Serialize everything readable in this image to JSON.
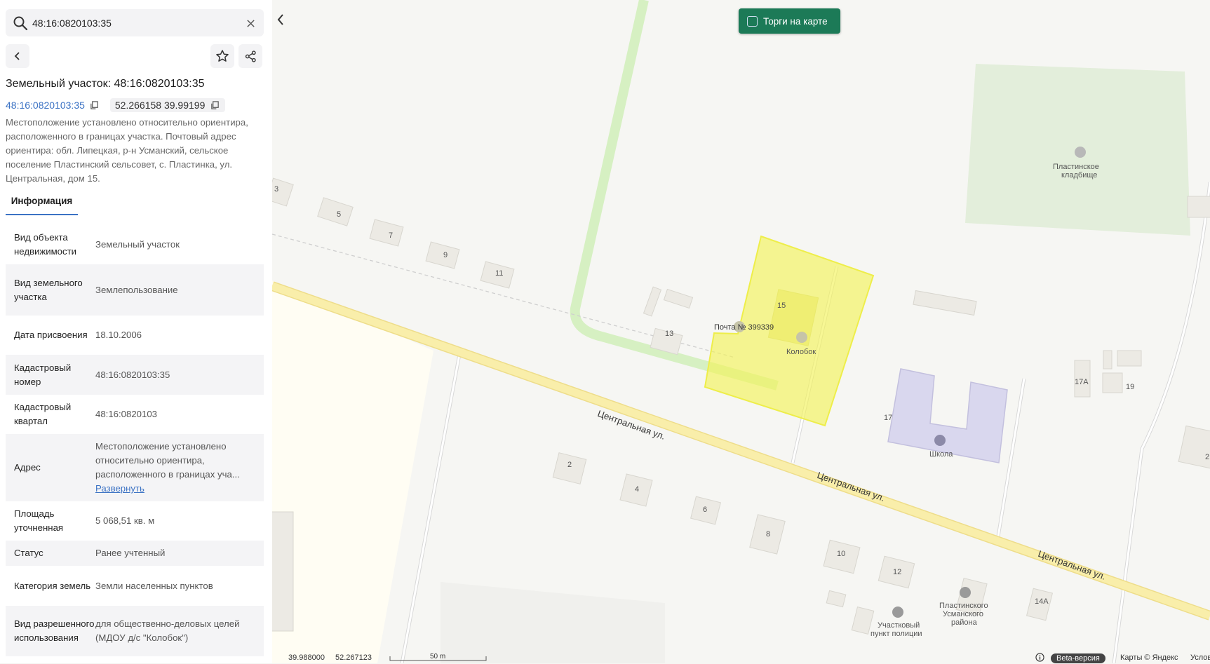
{
  "search": {
    "value": "48:16:0820103:35",
    "placeholder": ""
  },
  "title": "Земельный участок: 48:16:0820103:35",
  "cadastral_number": "48:16:0820103:35",
  "coordinates": "52.266158 39.99199",
  "description": "Местоположение установлено относительно ориентира, расположенного в границах участка. Почтовый адрес ориентира: обл. Липецкая, р-н Усманский, сельское поселение Пластинский сельсовет, с. Пластинка, ул. Центральная, дом 15.",
  "tabs": [
    {
      "label": "Информация"
    }
  ],
  "info": [
    {
      "key": "Вид объекта недвижимости",
      "value": "Земельный участок"
    },
    {
      "key": "Вид земельного участка",
      "value": "Землепользование"
    },
    {
      "key": "Дата присвоения",
      "value": "18.10.2006"
    },
    {
      "key": "Кадастровый номер",
      "value": "48:16:0820103:35"
    },
    {
      "key": "Кадастровый квартал",
      "value": "48:16:0820103"
    },
    {
      "key": "Адрес",
      "value": "Местоположение установлено относительно ориентира, расположенного в границах уча...",
      "link": "Развернуть"
    },
    {
      "key": "Площадь уточненная",
      "value": "5 068,51 кв. м"
    },
    {
      "key": "Статус",
      "value": "Ранее учтенный"
    },
    {
      "key": "Категория земель",
      "value": "Земли населенных пунктов"
    },
    {
      "key": "Вид разрешенного использования",
      "value": "для общественно-деловых целей (МДОУ д/с \"Колобок\")"
    }
  ],
  "map": {
    "auction_label": "Торги на карте",
    "street_label": "Центральная ул.",
    "poi": {
      "post": "Почта № 399339",
      "kolobok": "Колобок",
      "school": "Школа",
      "cemetery_1": "Пластинское",
      "cemetery_2": "кладбище",
      "police_1": "Участковый",
      "police_2": "пункт полиции",
      "admin_1": "Пластинского",
      "admin_2": "Усманского",
      "admin_3": "района"
    },
    "house_numbers": [
      "3",
      "5",
      "7",
      "9",
      "11",
      "13",
      "15",
      "2",
      "4",
      "6",
      "8",
      "10",
      "12",
      "14А",
      "17",
      "17А",
      "19",
      "2"
    ],
    "bottom": {
      "lon": "39.988000",
      "lat": "52.267123",
      "scale": "50 m",
      "beta": "Beta-версия",
      "copyright": "Карты © Яндекс",
      "terms": "Услов"
    }
  },
  "colors": {
    "accent": "#3b72c4",
    "auction": "#1c7a57",
    "parcel": "#f2f25a",
    "road": "#f7ec9f",
    "green": "#cfeebb"
  }
}
